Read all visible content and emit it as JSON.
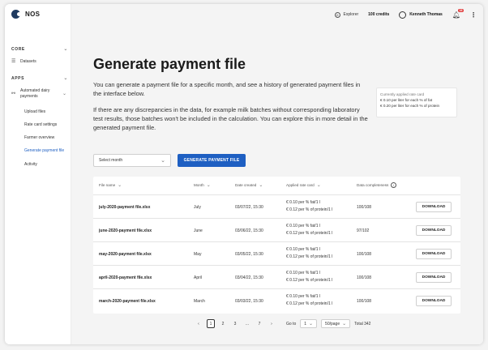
{
  "app": {
    "name": "NOS"
  },
  "sidebar": {
    "sections": [
      {
        "label": "CORE",
        "items": [
          {
            "label": "Datasets"
          }
        ]
      },
      {
        "label": "APPS",
        "items": [
          {
            "label": "Automated dairy payments",
            "children": [
              {
                "label": "Upload files"
              },
              {
                "label": "Rate card settings"
              },
              {
                "label": "Farmer overview"
              },
              {
                "label": "Generate payment file",
                "active": true
              },
              {
                "label": "Activity"
              }
            ]
          }
        ]
      }
    ]
  },
  "topbar": {
    "explorer_label": "Explorer",
    "credits": "100 credits",
    "user_name": "Kenneth Thomas",
    "notification_count": "16"
  },
  "page": {
    "title": "Generate payment file",
    "description_1": "You can generate a payment file for a specific month, and see a history of generated payment files in the interface below.",
    "description_2": "If there are any discrepancies in the data, for example milk batches without corresponding laboratory test results, those batches won't be included in the calculation. You can explore this in more detail in the generated payment file."
  },
  "rate_card": {
    "title": "Currently applied rate card",
    "line1": "€ 0.10 per liter for each % of fat",
    "line2": "€ 0.20 per liter for each % of protein"
  },
  "controls": {
    "select_month_placeholder": "Select month",
    "generate_button": "GENERATE PAYMENT FILE"
  },
  "table": {
    "headers": [
      "File name",
      "Month",
      "Date created",
      "Applied rate card",
      "Data completeness"
    ],
    "download_label": "DOWNLOAD",
    "rows": [
      {
        "file": "july-2020-payment file.xlsx",
        "month": "July",
        "date": "03/07/22, 15:30",
        "rate1": "€ 0.10 per % fat/1 l",
        "rate2": "€ 0.12 per % of protein/1 l",
        "completeness": "100/108"
      },
      {
        "file": "june-2020-payment file.xlsx",
        "month": "June",
        "date": "03/06/22, 15:30",
        "rate1": "€ 0.10 per % fat/1 l",
        "rate2": "€ 0.12 per % of protein/1 l",
        "completeness": "97/102"
      },
      {
        "file": "may-2020-payment file.xlsx",
        "month": "May",
        "date": "03/05/22, 15:30",
        "rate1": "€ 0.10 per % fat/1 l",
        "rate2": "€ 0.12 per % of protein/1 l",
        "completeness": "100/108"
      },
      {
        "file": "april-2020-payment file.xlsx",
        "month": "April",
        "date": "03/04/22, 15:30",
        "rate1": "€ 0.10 per % fat/1 l",
        "rate2": "€ 0.12 per % of protein/1 l",
        "completeness": "100/108"
      },
      {
        "file": "march-2020-payment file.xlsx",
        "month": "March",
        "date": "03/03/22, 15:30",
        "rate1": "€ 0.10 per % fat/1 l",
        "rate2": "€ 0.12 per % of protein/1 l",
        "completeness": "100/108"
      }
    ]
  },
  "pagination": {
    "pages": [
      "1",
      "2",
      "3",
      "...",
      "7"
    ],
    "current": "1",
    "goto_label": "Go to",
    "goto_value": "1",
    "per_page": "50/page",
    "total": "Total 342"
  }
}
